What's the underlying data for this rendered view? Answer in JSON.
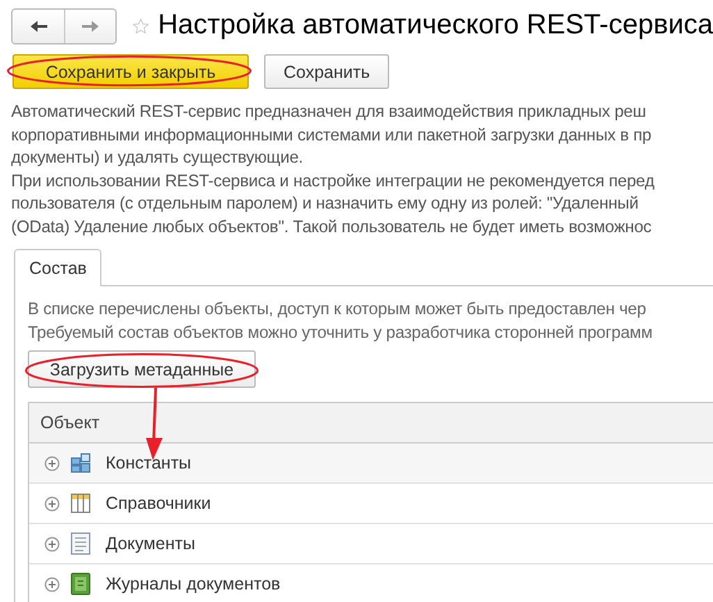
{
  "window": {
    "title": "Настройка автоматического REST-сервиса",
    "favorite": false
  },
  "commands": [
    {
      "label": "Сохранить и закрыть",
      "kind": "primary",
      "circled": true
    },
    {
      "label": "Сохранить",
      "kind": "default",
      "circled": false
    }
  ],
  "description": [
    "Автоматический REST-сервис предназначен для взаимодействия прикладных реш",
    "корпоративными информационными системами или пакетной загрузки данных в пр",
    "документы) и удалять существующие.",
    "При использовании REST-сервиса и настройке интеграции не рекомендуется перед",
    "пользователя (с отдельным паролем) и назначить ему одну из ролей: \"Удаленный",
    "(OData) Удаление любых объектов\". Такой пользователь не будет иметь возможнос"
  ],
  "tabs": [
    {
      "label": "Состав",
      "selected": true
    }
  ],
  "tab_text": [
    "В списке перечислены объекты, доступ к которым может быть предоставлен чер",
    "Требуемый состав объектов можно уточнить у разработчика сторонней программ"
  ],
  "load_button": {
    "label": "Загрузить метаданные",
    "circled": true,
    "arrow": true
  },
  "table": {
    "columns": [
      "Объект"
    ],
    "rows": [
      {
        "label": "Константы",
        "kind": "constants",
        "expanded": false
      },
      {
        "label": "Справочники",
        "kind": "catalogs",
        "expanded": false
      },
      {
        "label": "Документы",
        "kind": "documents",
        "expanded": false
      },
      {
        "label": "Журналы документов",
        "kind": "journals",
        "expanded": false
      }
    ]
  }
}
